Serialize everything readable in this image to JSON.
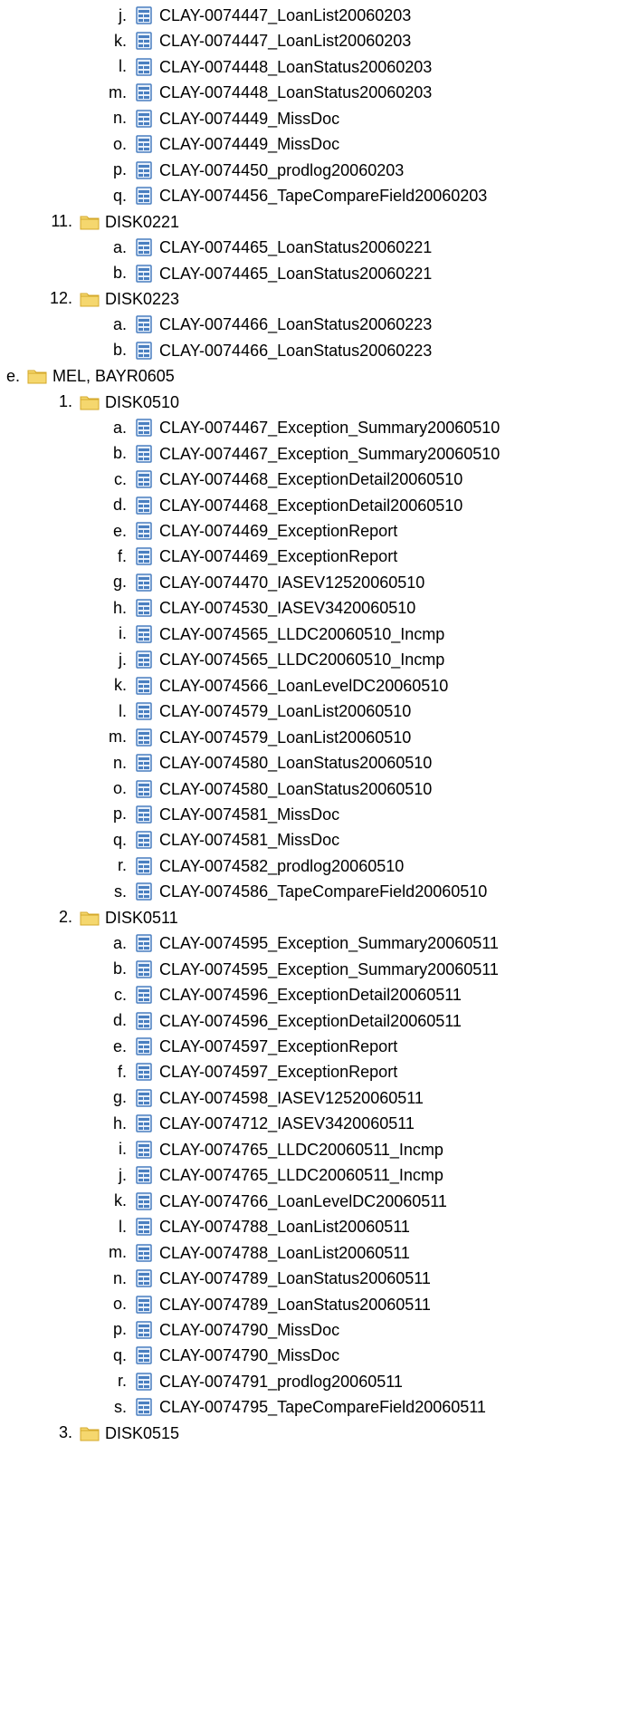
{
  "tree": {
    "rows": [
      {
        "marker": "j.",
        "icon": "document-icon",
        "label": "CLAY-0074447_LoanList20060203",
        "level": 3
      },
      {
        "marker": "k.",
        "icon": "document-icon",
        "label": "CLAY-0074447_LoanList20060203",
        "level": 3
      },
      {
        "marker": "l.",
        "icon": "document-icon",
        "label": "CLAY-0074448_LoanStatus20060203",
        "level": 3
      },
      {
        "marker": "m.",
        "icon": "document-icon",
        "label": "CLAY-0074448_LoanStatus20060203",
        "level": 3
      },
      {
        "marker": "n.",
        "icon": "document-icon",
        "label": "CLAY-0074449_MissDoc",
        "level": 3
      },
      {
        "marker": "o.",
        "icon": "document-icon",
        "label": "CLAY-0074449_MissDoc",
        "level": 3
      },
      {
        "marker": "p.",
        "icon": "document-icon",
        "label": "CLAY-0074450_prodlog20060203",
        "level": 3
      },
      {
        "marker": "q.",
        "icon": "document-icon",
        "label": "CLAY-0074456_TapeCompareField20060203",
        "level": 3
      },
      {
        "marker": "11.",
        "icon": "folder-icon",
        "label": "DISK0221",
        "level": 2
      },
      {
        "marker": "a.",
        "icon": "document-icon",
        "label": "CLAY-0074465_LoanStatus20060221",
        "level": 3
      },
      {
        "marker": "b.",
        "icon": "document-icon",
        "label": "CLAY-0074465_LoanStatus20060221",
        "level": 3
      },
      {
        "marker": "12.",
        "icon": "folder-icon",
        "label": "DISK0223",
        "level": 2
      },
      {
        "marker": "a.",
        "icon": "document-icon",
        "label": "CLAY-0074466_LoanStatus20060223",
        "level": 3
      },
      {
        "marker": "b.",
        "icon": "document-icon",
        "label": "CLAY-0074466_LoanStatus20060223",
        "level": 3
      },
      {
        "marker": "e.",
        "icon": "folder-icon",
        "label": "MEL, BAYR0605",
        "level": 1
      },
      {
        "marker": "1.",
        "icon": "folder-icon",
        "label": "DISK0510",
        "level": 2
      },
      {
        "marker": "a.",
        "icon": "document-icon",
        "label": "CLAY-0074467_Exception_Summary20060510",
        "level": 3
      },
      {
        "marker": "b.",
        "icon": "document-icon",
        "label": "CLAY-0074467_Exception_Summary20060510",
        "level": 3
      },
      {
        "marker": "c.",
        "icon": "document-icon",
        "label": "CLAY-0074468_ExceptionDetail20060510",
        "level": 3
      },
      {
        "marker": "d.",
        "icon": "document-icon",
        "label": "CLAY-0074468_ExceptionDetail20060510",
        "level": 3
      },
      {
        "marker": "e.",
        "icon": "document-icon",
        "label": "CLAY-0074469_ExceptionReport",
        "level": 3
      },
      {
        "marker": "f.",
        "icon": "document-icon",
        "label": "CLAY-0074469_ExceptionReport",
        "level": 3
      },
      {
        "marker": "g.",
        "icon": "document-icon",
        "label": "CLAY-0074470_IASEV12520060510",
        "level": 3
      },
      {
        "marker": "h.",
        "icon": "document-icon",
        "label": "CLAY-0074530_IASEV3420060510",
        "level": 3
      },
      {
        "marker": "i.",
        "icon": "document-icon",
        "label": "CLAY-0074565_LLDC20060510_Incmp",
        "level": 3
      },
      {
        "marker": "j.",
        "icon": "document-icon",
        "label": "CLAY-0074565_LLDC20060510_Incmp",
        "level": 3
      },
      {
        "marker": "k.",
        "icon": "document-icon",
        "label": "CLAY-0074566_LoanLevelDC20060510",
        "level": 3
      },
      {
        "marker": "l.",
        "icon": "document-icon",
        "label": "CLAY-0074579_LoanList20060510",
        "level": 3
      },
      {
        "marker": "m.",
        "icon": "document-icon",
        "label": "CLAY-0074579_LoanList20060510",
        "level": 3
      },
      {
        "marker": "n.",
        "icon": "document-icon",
        "label": "CLAY-0074580_LoanStatus20060510",
        "level": 3
      },
      {
        "marker": "o.",
        "icon": "document-icon",
        "label": "CLAY-0074580_LoanStatus20060510",
        "level": 3
      },
      {
        "marker": "p.",
        "icon": "document-icon",
        "label": "CLAY-0074581_MissDoc",
        "level": 3
      },
      {
        "marker": "q.",
        "icon": "document-icon",
        "label": "CLAY-0074581_MissDoc",
        "level": 3
      },
      {
        "marker": "r.",
        "icon": "document-icon",
        "label": "CLAY-0074582_prodlog20060510",
        "level": 3
      },
      {
        "marker": "s.",
        "icon": "document-icon",
        "label": "CLAY-0074586_TapeCompareField20060510",
        "level": 3
      },
      {
        "marker": "2.",
        "icon": "folder-icon",
        "label": "DISK0511",
        "level": 2
      },
      {
        "marker": "a.",
        "icon": "document-icon",
        "label": "CLAY-0074595_Exception_Summary20060511",
        "level": 3
      },
      {
        "marker": "b.",
        "icon": "document-icon",
        "label": "CLAY-0074595_Exception_Summary20060511",
        "level": 3
      },
      {
        "marker": "c.",
        "icon": "document-icon",
        "label": "CLAY-0074596_ExceptionDetail20060511",
        "level": 3
      },
      {
        "marker": "d.",
        "icon": "document-icon",
        "label": "CLAY-0074596_ExceptionDetail20060511",
        "level": 3
      },
      {
        "marker": "e.",
        "icon": "document-icon",
        "label": "CLAY-0074597_ExceptionReport",
        "level": 3
      },
      {
        "marker": "f.",
        "icon": "document-icon",
        "label": "CLAY-0074597_ExceptionReport",
        "level": 3
      },
      {
        "marker": "g.",
        "icon": "document-icon",
        "label": "CLAY-0074598_IASEV12520060511",
        "level": 3
      },
      {
        "marker": "h.",
        "icon": "document-icon",
        "label": "CLAY-0074712_IASEV3420060511",
        "level": 3
      },
      {
        "marker": "i.",
        "icon": "document-icon",
        "label": "CLAY-0074765_LLDC20060511_Incmp",
        "level": 3
      },
      {
        "marker": "j.",
        "icon": "document-icon",
        "label": "CLAY-0074765_LLDC20060511_Incmp",
        "level": 3
      },
      {
        "marker": "k.",
        "icon": "document-icon",
        "label": "CLAY-0074766_LoanLevelDC20060511",
        "level": 3
      },
      {
        "marker": "l.",
        "icon": "document-icon",
        "label": "CLAY-0074788_LoanList20060511",
        "level": 3
      },
      {
        "marker": "m.",
        "icon": "document-icon",
        "label": "CLAY-0074788_LoanList20060511",
        "level": 3
      },
      {
        "marker": "n.",
        "icon": "document-icon",
        "label": "CLAY-0074789_LoanStatus20060511",
        "level": 3
      },
      {
        "marker": "o.",
        "icon": "document-icon",
        "label": "CLAY-0074789_LoanStatus20060511",
        "level": 3
      },
      {
        "marker": "p.",
        "icon": "document-icon",
        "label": "CLAY-0074790_MissDoc",
        "level": 3
      },
      {
        "marker": "q.",
        "icon": "document-icon",
        "label": "CLAY-0074790_MissDoc",
        "level": 3
      },
      {
        "marker": "r.",
        "icon": "document-icon",
        "label": "CLAY-0074791_prodlog20060511",
        "level": 3
      },
      {
        "marker": "s.",
        "icon": "document-icon",
        "label": "CLAY-0074795_TapeCompareField20060511",
        "level": 3
      },
      {
        "marker": "3.",
        "icon": "folder-icon",
        "label": "DISK0515",
        "level": 2
      }
    ]
  },
  "colors": {
    "folder": "#f5d76e",
    "folder_edge": "#d4a82a",
    "document": "#4a7fc0"
  }
}
